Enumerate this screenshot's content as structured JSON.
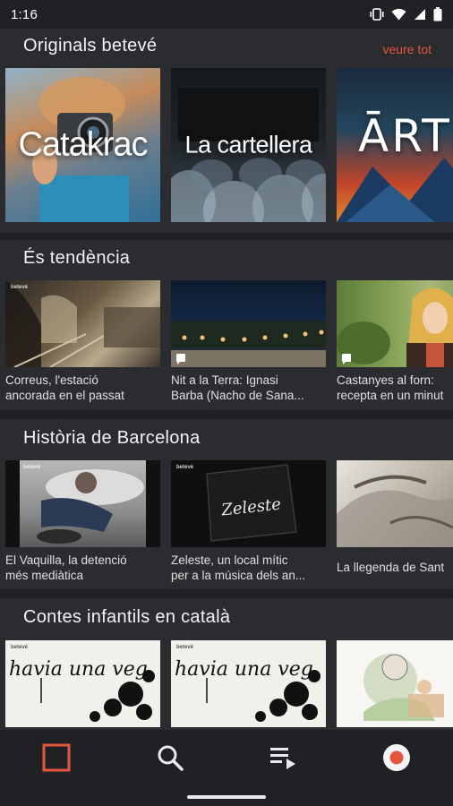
{
  "status_bar": {
    "time": "1:16",
    "icons": [
      "vibrate-icon",
      "wifi-icon",
      "signal-icon",
      "battery-icon"
    ]
  },
  "colors": {
    "accent": "#e8553e",
    "background": "#202124",
    "section": "#2a2c30"
  },
  "sections": [
    {
      "title": "Originals betevé",
      "see_all": "veure tot",
      "items": [
        {
          "title": "Catakrac"
        },
        {
          "title": "La cartellera"
        },
        {
          "title": "ĀRTIC"
        }
      ]
    },
    {
      "title": "És tendència",
      "items": [
        {
          "line1": "Correus, l'estació",
          "line2": "ancorada en el passat"
        },
        {
          "line1": "Nit a la Terra: Ignasi",
          "line2": "Barba (Nacho de Sana..."
        },
        {
          "line1": "Castanyes al forn:",
          "line2": "recepta en un minut"
        }
      ]
    },
    {
      "title": "Història de Barcelona",
      "items": [
        {
          "line1": "El Vaquilla, la detenció",
          "line2": "més mediàtica"
        },
        {
          "line1": "Zeleste, un local mític",
          "line2": "per a la música dels an..."
        },
        {
          "line1": "La llegenda de Sant",
          "line2": ""
        }
      ]
    },
    {
      "title": "Contes infantils en català",
      "items": [
        {
          "thumb_text": "havia una veg"
        },
        {
          "thumb_text": "havia una veg"
        },
        {
          "thumb_text": ""
        }
      ]
    }
  ],
  "nav": [
    {
      "name": "home",
      "icon": "square-home-icon",
      "active": true
    },
    {
      "name": "search",
      "icon": "search-icon",
      "active": false
    },
    {
      "name": "playlist",
      "icon": "playlist-icon",
      "active": false
    },
    {
      "name": "live",
      "icon": "live-record-icon",
      "active": false
    }
  ]
}
